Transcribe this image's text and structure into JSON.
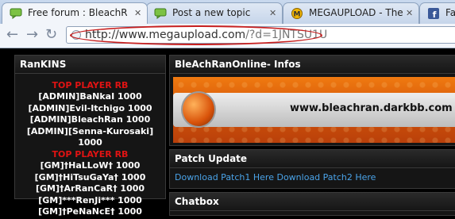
{
  "browser": {
    "tabs": [
      {
        "title": "Free forum : BleachRan",
        "icon": "forum-icon",
        "active": true
      },
      {
        "title": "Post a new topic",
        "icon": "forum-icon",
        "active": false
      },
      {
        "title": "MEGAUPLOAD - The le",
        "icon": "megaupload-icon",
        "active": false
      },
      {
        "title": "Fac",
        "icon": "facebook-icon",
        "active": false
      }
    ],
    "address": {
      "url_main": "http://www.megaupload.com",
      "url_query": "/?d=1JNTSU1U"
    },
    "annotation_color": "#c71f1f"
  },
  "left_panel": {
    "title": "RanKINS",
    "sections": [
      {
        "heading": "TOP PLAYER RB",
        "rows": [
          "[ADMIN]BaNkaI 1000",
          "[ADMIN]Evil-Itchigo 1000",
          "[ADMIN]BleachRan 1000",
          "[ADMIN][Senna-Kurosaki] 1000"
        ]
      },
      {
        "heading": "TOP PLAYER RB",
        "rows": [
          "[GM]†HaLLoW† 1000",
          "[GM]†HiTsuGaYa† 1000",
          "[GM]†ArRanCaR† 1000",
          "[GM]***RenJi*** 1000",
          "[GM]†PeNaNcE† 1000"
        ]
      }
    ]
  },
  "right_panel": {
    "infos_title": "BleAchRanOnline- Infos",
    "banner_text": "www.bleachran.darkbb.com",
    "patch_title": "Patch Update",
    "patch_link1": "Download Patch1 Here",
    "patch_link2": "Download Patch2 Here",
    "chatbox_title": "Chatbox"
  },
  "colors": {
    "accent_red": "#e01313",
    "link_blue": "#4aa3e8",
    "banner_orange": "#e8680d"
  }
}
